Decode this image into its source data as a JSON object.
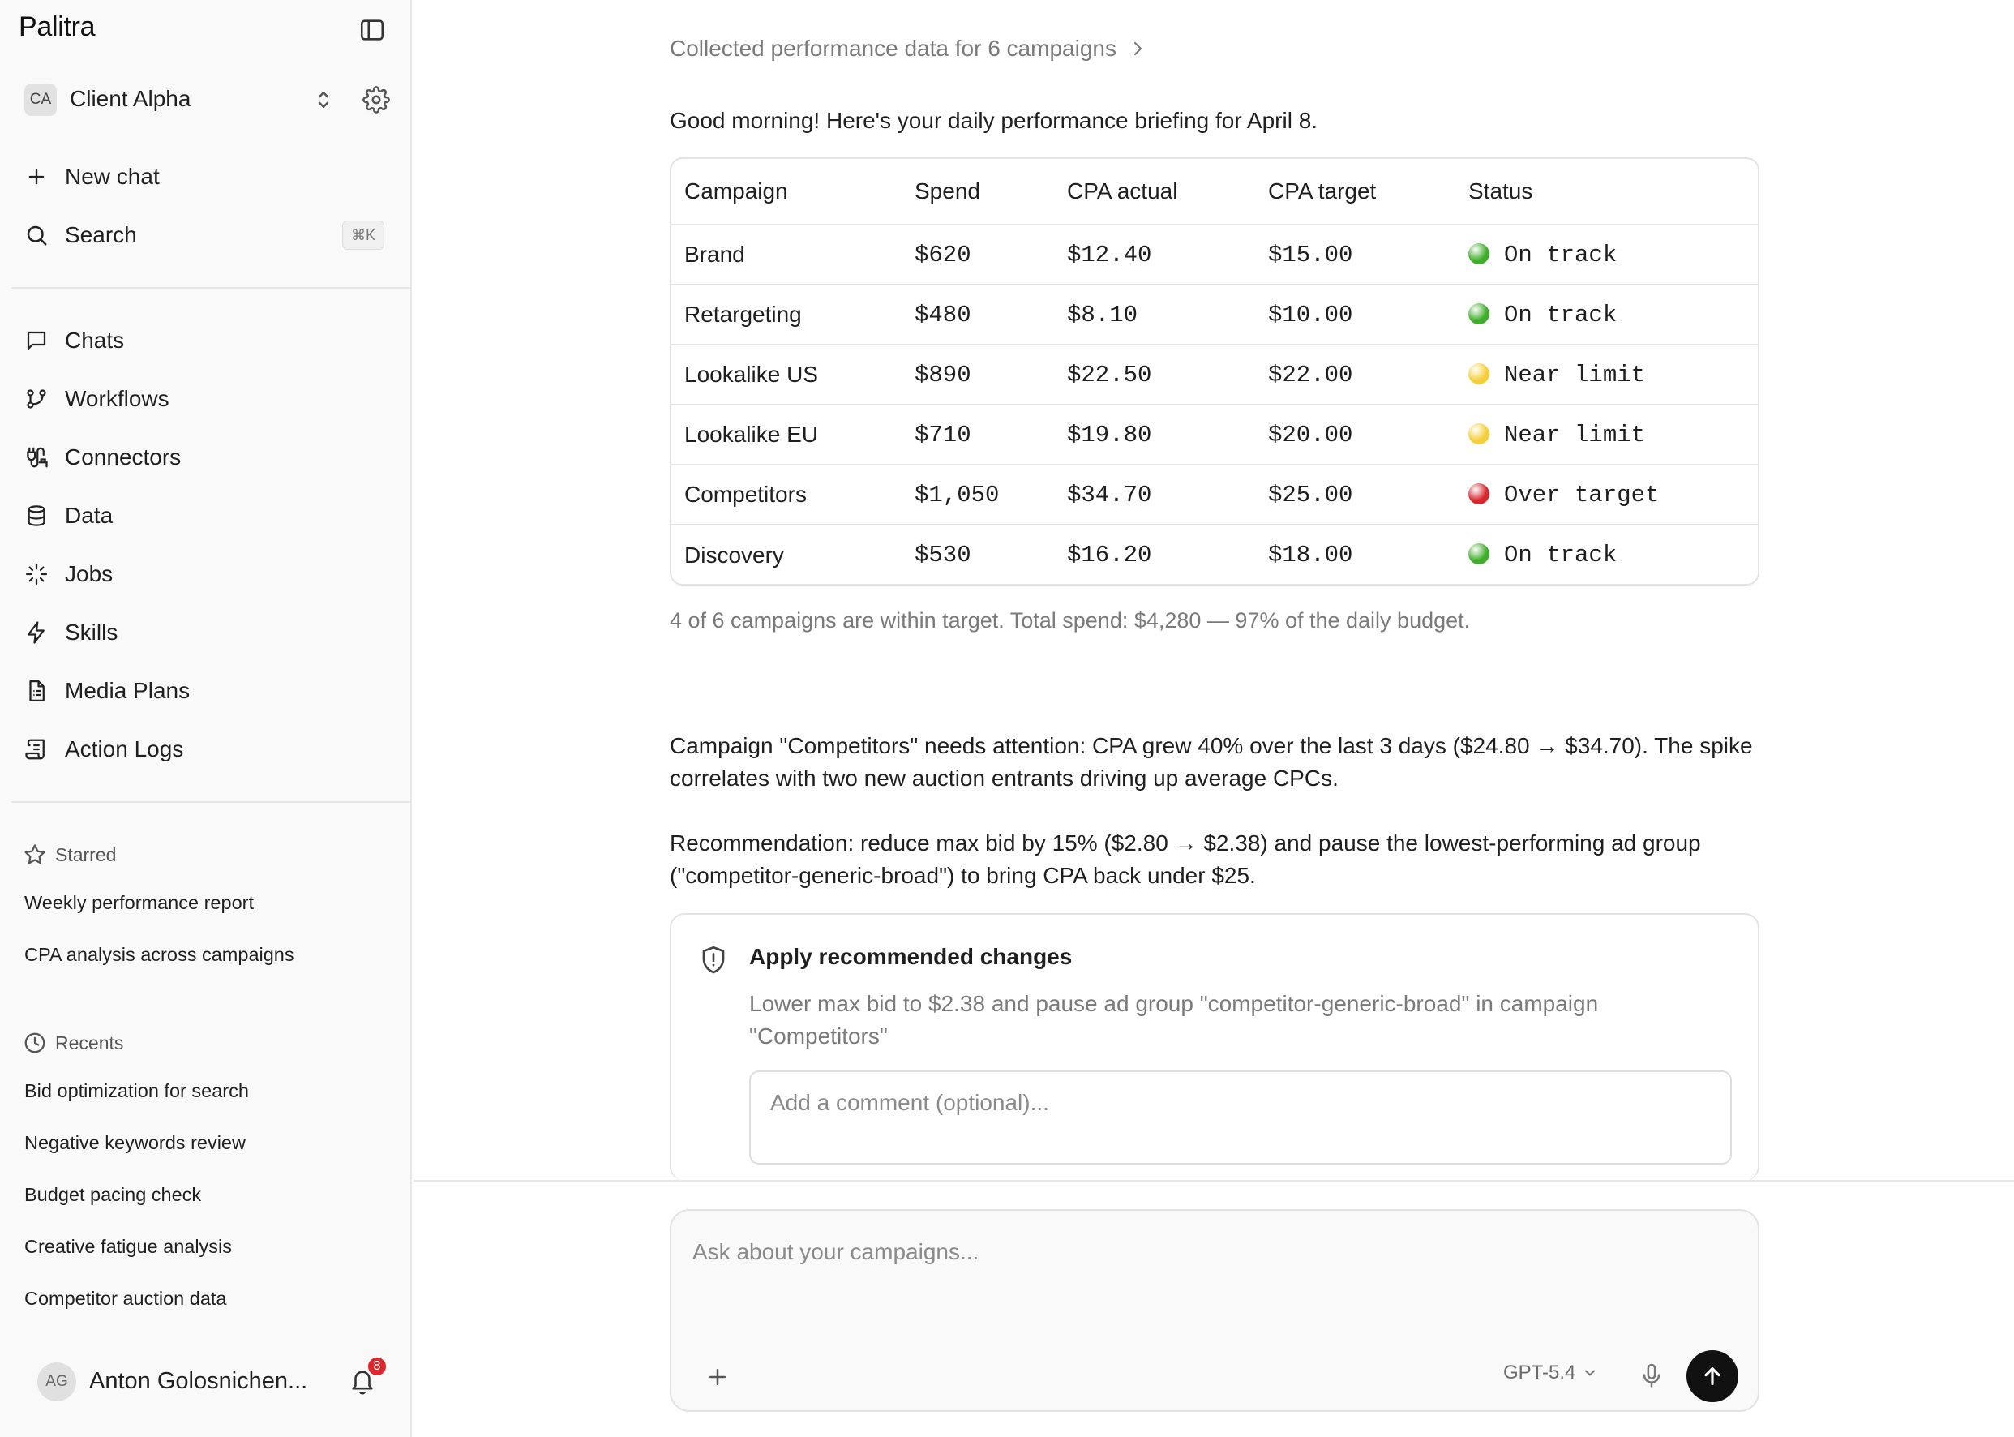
{
  "app": {
    "title": "Palitra"
  },
  "client": {
    "initials": "CA",
    "name": "Client Alpha"
  },
  "sidebar": {
    "new_chat": "New chat",
    "search": "Search",
    "search_shortcut": "⌘K",
    "nav": [
      {
        "label": "Chats",
        "icon": "chat-bubble-icon"
      },
      {
        "label": "Workflows",
        "icon": "workflow-icon"
      },
      {
        "label": "Connectors",
        "icon": "connector-icon"
      },
      {
        "label": "Data",
        "icon": "database-icon"
      },
      {
        "label": "Jobs",
        "icon": "loader-icon"
      },
      {
        "label": "Skills",
        "icon": "lightning-icon"
      },
      {
        "label": "Media Plans",
        "icon": "document-icon"
      },
      {
        "label": "Action Logs",
        "icon": "scroll-icon"
      }
    ],
    "starred_label": "Starred",
    "starred": [
      "Weekly performance report",
      "CPA analysis across campaigns"
    ],
    "recents_label": "Recents",
    "recents": [
      "Bid optimization for search",
      "Negative keywords review",
      "Budget pacing check",
      "Creative fatigue analysis",
      "Competitor auction data"
    ]
  },
  "user": {
    "initials": "AG",
    "name": "Anton Golosnichen...",
    "notifications": "8"
  },
  "conversation": {
    "breadcrumb": "Collected performance data for 6 campaigns",
    "greeting": "Good morning! Here's your daily performance briefing for April 8.",
    "table": {
      "headers": [
        "Campaign",
        "Spend",
        "CPA actual",
        "CPA target",
        "Status"
      ],
      "rows": [
        {
          "campaign": "Brand",
          "spend": "$620",
          "cpa_actual": "$12.40",
          "cpa_target": "$15.00",
          "status": "On track",
          "status_color": "#3fae2a"
        },
        {
          "campaign": "Retargeting",
          "spend": "$480",
          "cpa_actual": "$8.10",
          "cpa_target": "$10.00",
          "status": "On track",
          "status_color": "#3fae2a"
        },
        {
          "campaign": "Lookalike US",
          "spend": "$890",
          "cpa_actual": "$22.50",
          "cpa_target": "$22.00",
          "status": "Near limit",
          "status_color": "#f5cf3a"
        },
        {
          "campaign": "Lookalike EU",
          "spend": "$710",
          "cpa_actual": "$19.80",
          "cpa_target": "$20.00",
          "status": "Near limit",
          "status_color": "#f5cf3a"
        },
        {
          "campaign": "Competitors",
          "spend": "$1,050",
          "cpa_actual": "$34.70",
          "cpa_target": "$25.00",
          "status": "Over target",
          "status_color": "#d8262b"
        },
        {
          "campaign": "Discovery",
          "spend": "$530",
          "cpa_actual": "$16.20",
          "cpa_target": "$18.00",
          "status": "On track",
          "status_color": "#3fae2a"
        }
      ]
    },
    "summary": "4 of 6 campaigns are within target. Total spend: $4,280 — 97% of the daily budget.",
    "attention": "Campaign \"Competitors\" needs attention: CPA grew 40% over the last 3 days ($24.80 → $34.70). The spike correlates with two new auction entrants driving up average CPCs.",
    "recommendation": "Recommendation: reduce max bid by 15% ($2.80 → $2.38) and pause the lowest-performing ad group (\"competitor-generic-broad\") to bring CPA back under $25.",
    "approval": {
      "title": "Apply recommended changes",
      "description": "Lower max bid to $2.38 and pause ad group \"competitor-generic-broad\" in campaign \"Competitors\"",
      "comment_placeholder": "Add a comment (optional)..."
    }
  },
  "composer": {
    "placeholder": "Ask about your campaigns...",
    "model": "GPT-5.4"
  }
}
